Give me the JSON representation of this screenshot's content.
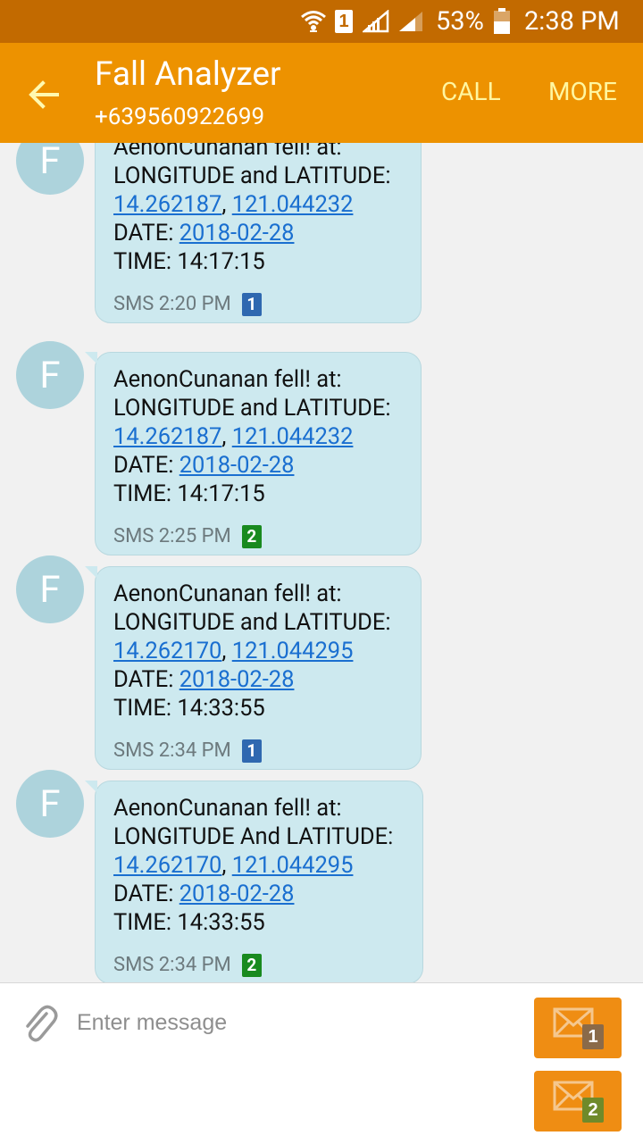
{
  "status_bar": {
    "sim_slot": "1",
    "battery": "53%",
    "time": "2:38 PM"
  },
  "app_bar": {
    "title": "Fall Analyzer",
    "phone": "+639560922699",
    "call_label": "CALL",
    "more_label": "MORE"
  },
  "colors": {
    "status_bar": "#c26a00",
    "app_bar": "#ed9200",
    "action_text": "#fff6a0",
    "bubble": "#cde9ef",
    "avatar": "#add3dc",
    "link": "#1a6fd0",
    "sim1": "#2f68b0",
    "sim2": "#198a1f",
    "send_button": "#ef8d13"
  },
  "messages": [
    {
      "avatar_letter": "F",
      "line1": "AenonCunanan fell! at:",
      "line2": "LONGITUDE and LATITUDE:",
      "lat": "14.262187",
      "comma": ",",
      "lon": "121.044232",
      "date_label": "DATE:",
      "date": "2018-02-28",
      "time_label": "TIME:",
      "time": "14:17:15",
      "meta": "SMS 2:20 PM",
      "sim": "1"
    },
    {
      "avatar_letter": "F",
      "line1": "AenonCunanan fell! at:",
      "line2": "LONGITUDE and LATITUDE:",
      "lat": "14.262187",
      "comma": ",",
      "lon": "121.044232",
      "date_label": "DATE:",
      "date": "2018-02-28",
      "time_label": "TIME:",
      "time": "14:17:15",
      "meta": "SMS 2:25 PM",
      "sim": "2"
    },
    {
      "avatar_letter": "F",
      "line1": "AenonCunanan fell! at:",
      "line2": "LONGITUDE and LATITUDE:",
      "lat": "14.262170",
      "comma": ",",
      "lon": "121.044295",
      "date_label": "DATE:",
      "date": "2018-02-28",
      "time_label": "TIME:",
      "time": "14:33:55",
      "meta": "SMS 2:34 PM",
      "sim": "1"
    },
    {
      "avatar_letter": "F",
      "line1": "AenonCunanan fell! at:",
      "line2": "LONGITUDE And LATITUDE:",
      "lat": "14.262170",
      "comma": ",",
      "lon": "121.044295",
      "date_label": "DATE:",
      "date": "2018-02-28",
      "time_label": "TIME:",
      "time": "14:33:55",
      "meta": "SMS 2:34 PM",
      "sim": "2"
    }
  ],
  "composer": {
    "placeholder": "Enter message",
    "send_sim1": "1",
    "send_sim2": "2"
  }
}
